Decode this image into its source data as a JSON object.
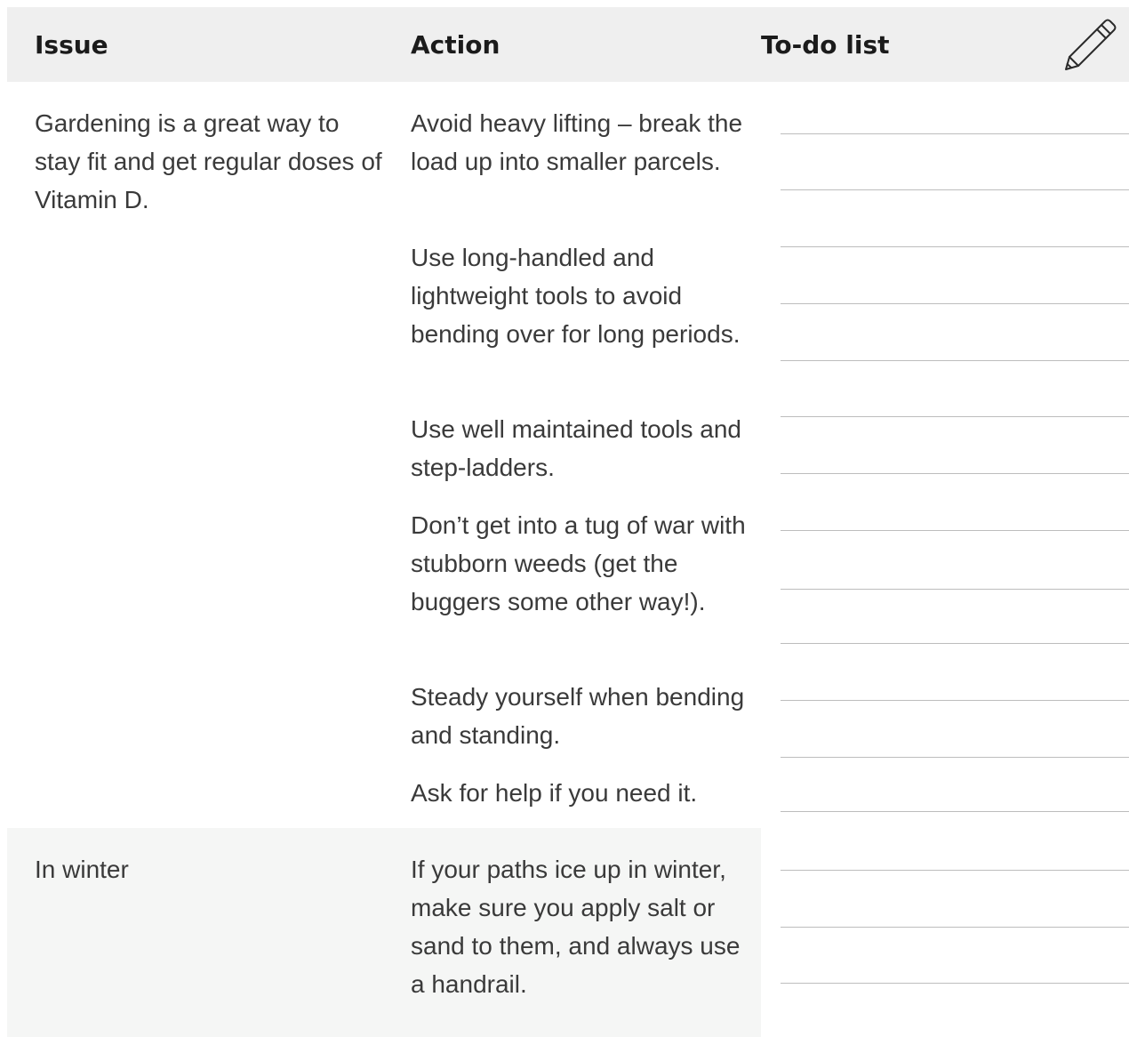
{
  "header": {
    "issue_label": "Issue",
    "action_label": "Action",
    "todo_label": "To-do list",
    "icon": "pencil-icon"
  },
  "rows": [
    {
      "issue": "Gardening is a great way to stay fit and get regular doses of Vitamin D.",
      "actions": [
        "Avoid heavy lifting – break the load up into smaller parcels.",
        "Use long-handled and lightweight tools to avoid bending over for long periods.",
        "Use well maintained tools and step-ladders.",
        "Don’t get into a tug of war with stubborn weeds (get the buggers some other way!).",
        "Steady yourself when bending and standing.",
        "Ask for help if you need it."
      ]
    },
    {
      "issue": "In winter",
      "actions": [
        "If your paths ice up in winter, make sure you apply salt or sand to them, and always use a handrail."
      ]
    }
  ],
  "colors": {
    "header_bg": "#efefef",
    "winter_row_bg": "#f5f6f5",
    "text": "#3a3a3a",
    "header_text": "#1b1b1b",
    "line": "#bdbdbd"
  }
}
